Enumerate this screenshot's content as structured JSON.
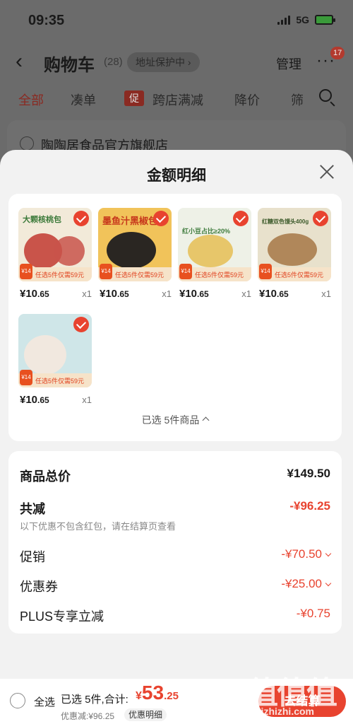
{
  "status_bar": {
    "time": "09:35",
    "network": "5G"
  },
  "cart_header": {
    "title": "购物车",
    "count": "(28)",
    "address_protect": "地址保护中",
    "manage": "管理",
    "notification_count": "17"
  },
  "tabs": [
    {
      "label": "全部"
    },
    {
      "label": "凑单"
    },
    {
      "label": "跨店满减",
      "tag": "促"
    },
    {
      "label": "降价"
    },
    {
      "label": "筛"
    }
  ],
  "store": {
    "name": "陶陶居食品官方旗舰店"
  },
  "modal": {
    "title": "金额明细",
    "items": [
      {
        "label": "大颗核桃包",
        "price": "¥10",
        "cents": ".65",
        "qty": "x1",
        "bg": "#f2ead9",
        "food": "#c9544a"
      },
      {
        "label": "墨鱼汁黑椒包",
        "price": "¥10",
        "cents": ".65",
        "qty": "x1",
        "bg": "#f1c35a",
        "food": "#2a2622"
      },
      {
        "label": "红小豆占比≥20%",
        "price": "¥10",
        "cents": ".65",
        "qty": "x1",
        "bg": "#eef1e7",
        "food": "#e7c66a"
      },
      {
        "label": "红糖双色馒头400g",
        "price": "¥10",
        "cents": ".65",
        "qty": "x1",
        "bg": "#e8e1cc",
        "food": "#b0875a"
      },
      {
        "label": "",
        "price": "¥10",
        "cents": ".65",
        "qty": "x1",
        "bg": "#cfe6e8",
        "food": "#f1e8df"
      }
    ],
    "strip_text": "任选5件仅需59元",
    "strip_price": "¥14",
    "selected_summary": "已选 5件商品"
  },
  "breakdown": {
    "total_label": "商品总价",
    "total_value": "¥149.50",
    "reduce_label": "共减",
    "reduce_value": "-¥96.25",
    "note": "以下优惠不包含红包，请在结算页查看",
    "promo_label": "促销",
    "promo_value": "-¥70.50",
    "coupon_label": "优惠券",
    "coupon_value": "-¥25.00",
    "plus_label": "PLUS专享立减",
    "plus_value": "-¥0.75"
  },
  "footer": {
    "select_all": "全选",
    "summary": "已选 5件,合计:",
    "amount_symbol": "¥",
    "amount_int": "53",
    "amount_dec": ".25",
    "discount": "优惠减:¥96.25",
    "detail": "优惠明细",
    "checkout": "去结算"
  },
  "watermark": {
    "big": "值值值",
    "small": "zhizhizhi.com"
  },
  "colors": {
    "accent": "#e8432f",
    "sheet_bg": "#f2f2f2",
    "overlay": "#6b6b6b"
  }
}
